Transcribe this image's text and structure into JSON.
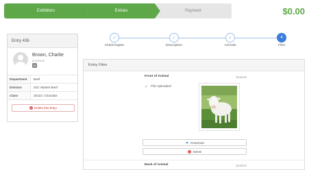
{
  "stepper": {
    "steps": [
      {
        "label": "Exhibitors",
        "state": "complete"
      },
      {
        "label": "Entries",
        "state": "current"
      },
      {
        "label": "Payment",
        "state": "pending"
      }
    ],
    "total": "$0.00",
    "colors": {
      "complete": "#5fa84a",
      "pending": "#e6e6e6"
    }
  },
  "entry": {
    "header": "Entry 436",
    "name": "Brown, Charlie",
    "dob": "8/13/2008",
    "badge": "M",
    "details": [
      {
        "label": "Department",
        "value": "Beef"
      },
      {
        "label": "Division",
        "value": "202: Market Beef"
      },
      {
        "label": "Class",
        "value": "20222: Charolais"
      }
    ],
    "delete_label": "Delete this Entry"
  },
  "progress": {
    "steps": [
      {
        "label": "Club/Chapter",
        "icon": "check-icon"
      },
      {
        "label": "Description",
        "icon": "check-icon"
      },
      {
        "label": "Animals",
        "icon": "check-icon"
      },
      {
        "label": "Files",
        "number": "4"
      }
    ]
  },
  "files": {
    "title": "Entry Files",
    "front": {
      "title": "Front of Animal",
      "optional": "Optional",
      "status": "File Uploaded",
      "download_label": "Download",
      "delete_label": "Delete"
    },
    "back": {
      "title": "Back of Animal",
      "optional": "Optional"
    }
  }
}
